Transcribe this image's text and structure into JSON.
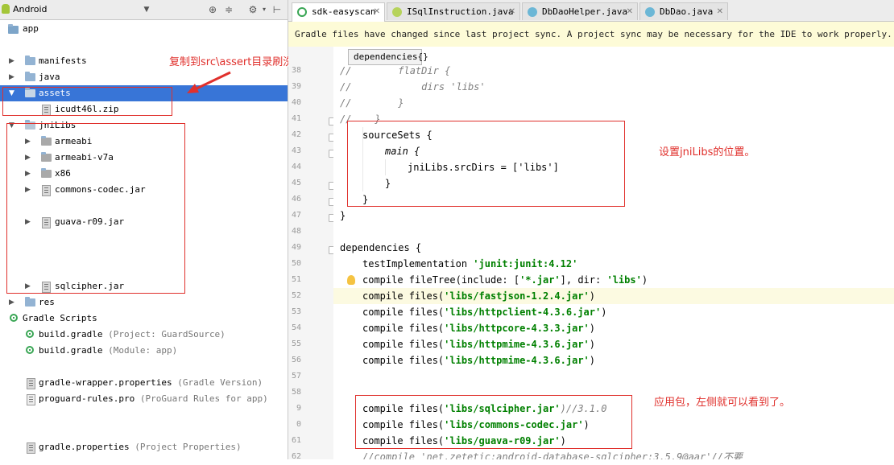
{
  "project_panel": {
    "view_selector": "Android",
    "tree": [
      {
        "label": "app",
        "note": ""
      },
      {
        "label": "manifests",
        "note": ""
      },
      {
        "label": "java",
        "note": ""
      },
      {
        "label": "assets",
        "note": ""
      },
      {
        "label": "icudt46l.zip",
        "note": ""
      },
      {
        "label": "jniLibs",
        "note": ""
      },
      {
        "label": "armeabi",
        "note": ""
      },
      {
        "label": "armeabi-v7a",
        "note": ""
      },
      {
        "label": "x86",
        "note": ""
      },
      {
        "label": "commons-codec.jar",
        "note": ""
      },
      {
        "label": "guava-r09.jar",
        "note": ""
      },
      {
        "label": "sqlcipher.jar",
        "note": ""
      },
      {
        "label": "res",
        "note": ""
      },
      {
        "label": "Gradle Scripts",
        "note": ""
      },
      {
        "label": "build.gradle",
        "note": "(Project: GuardSource)"
      },
      {
        "label": "build.gradle",
        "note": "(Module: app)"
      },
      {
        "label": "gradle-wrapper.properties",
        "note": "(Gradle Version)"
      },
      {
        "label": "proguard-rules.pro",
        "note": "(ProGuard Rules for app)"
      },
      {
        "label": "gradle.properties",
        "note": "(Project Properties)"
      }
    ]
  },
  "tabs": [
    {
      "label": "sdk-easyscan",
      "active": true
    },
    {
      "label": "ISqlInstruction.java",
      "active": false
    },
    {
      "label": "DbDaoHelper.java",
      "active": false
    },
    {
      "label": "DbDao.java",
      "active": false
    }
  ],
  "notification": "Gradle files have changed since last project sync. A project sync may be necessary for the IDE to work properly.",
  "breadcrumb_popup": "dependencies{}",
  "line_numbers": [
    "38",
    "39",
    "40",
    "41",
    "42",
    "43",
    "44",
    "45",
    "46",
    "47",
    "48",
    "49",
    "50",
    "51",
    "52",
    "53",
    "54",
    "55",
    "56",
    "57",
    "58",
    "9",
    "0",
    "61",
    "62"
  ],
  "code": {
    "l38": "//        flatDir {",
    "l39": "//            dirs 'libs'",
    "l40": "//        }",
    "l41": "//    }",
    "l42": "sourceSets {",
    "l43": "main {",
    "l44": "jniLibs.srcDirs = ['libs']",
    "l45": "}",
    "l46": "}",
    "l47": "}",
    "l49": "dependencies {",
    "l50_a": "testImplementation ",
    "l50_b": "'junit:junit:4.12'",
    "l51_a": "compile fileTree(include: [",
    "l51_b": "'*.jar'",
    "l51_c": "], dir: ",
    "l51_d": "'libs'",
    "l51_e": ")",
    "files": [
      "'libs/fastjson-1.2.4.jar'",
      "'libs/httpclient-4.3.6.jar'",
      "'libs/httpcore-4.3.3.jar'",
      "'libs/httpmime-4.3.6.jar'",
      "'libs/httpmime-4.3.6.jar'"
    ],
    "compile_files": "compile files(",
    "close_paren": ")",
    "l59_str": "'libs/sqlcipher.jar'",
    "l59_cm": ")//3.1.0",
    "l60_str": "'libs/commons-codec.jar'",
    "l61_str": "'libs/guava-r09.jar'",
    "l62": "//compile 'net.zetetic:android-database-sqlcipher:3.5.9@aar'//不要"
  },
  "annotations": {
    "assets": "复制到src\\assert目录刷洗就出来了。",
    "jnilibs": "设置jniLibs的位置。",
    "jars": "应用包，左侧就可以看到了。"
  },
  "colors": {
    "selection": "#3875d7",
    "annotation_red": "#e0302c",
    "string_green": "#008000",
    "notification_bg": "#fdfbd7"
  }
}
